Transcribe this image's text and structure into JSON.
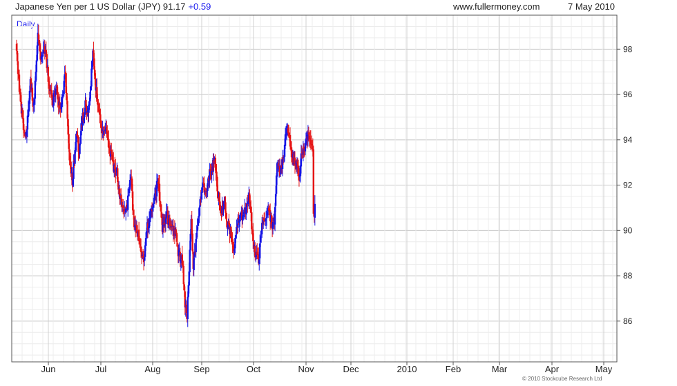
{
  "header": {
    "title": "Japanese Yen per 1 US Dollar (JPY) 91.17",
    "change": "+0.59",
    "site": "www.fullermoney.com",
    "date": "7 May 2010",
    "period": "Daily",
    "copyright": "© 2010 Stockcube Research Ltd"
  },
  "colors": {
    "up": "#1414e6",
    "down": "#e61414",
    "grid": "#d4d4d4",
    "axis": "#555555"
  },
  "chart_data": {
    "type": "candlestick",
    "title": "Japanese Yen per 1 US Dollar (JPY)",
    "last": 91.17,
    "change": 0.59,
    "ylim": [
      84.2,
      99.5
    ],
    "y_ticks": [
      86,
      88,
      90,
      92,
      94,
      96,
      98
    ],
    "x_ticks": [
      "Jun",
      "Jul",
      "Aug",
      "Sep",
      "Oct",
      "Nov",
      "Dec",
      "2010",
      "Feb",
      "Mar",
      "Apr",
      "May"
    ],
    "grid": true,
    "y_axis_side": "right",
    "anchors_comment_free": true,
    "price_path": [
      [
        0,
        97.9
      ],
      [
        7,
        95.2
      ],
      [
        14,
        94.0
      ],
      [
        20,
        96.6
      ],
      [
        25,
        95.5
      ],
      [
        31,
        98.7
      ],
      [
        35,
        97.4
      ],
      [
        41,
        98.0
      ],
      [
        46,
        96.8
      ],
      [
        52,
        95.6
      ],
      [
        58,
        96.2
      ],
      [
        63,
        95.3
      ],
      [
        71,
        97.0
      ],
      [
        77,
        93.0
      ],
      [
        81,
        92.2
      ],
      [
        87,
        94.3
      ],
      [
        91,
        93.5
      ],
      [
        95,
        94.8
      ],
      [
        100,
        95.5
      ],
      [
        104,
        94.9
      ],
      [
        111,
        97.8
      ],
      [
        116,
        96.1
      ],
      [
        122,
        94.6
      ],
      [
        131,
        94.3
      ],
      [
        141,
        92.7
      ],
      [
        146,
        92.5
      ],
      [
        153,
        91.0
      ],
      [
        159,
        90.7
      ],
      [
        166,
        92.4
      ],
      [
        171,
        90.2
      ],
      [
        177,
        89.7
      ],
      [
        185,
        88.5
      ],
      [
        189,
        90.0
      ],
      [
        198,
        91.1
      ],
      [
        206,
        92.2
      ],
      [
        212,
        90.0
      ],
      [
        218,
        90.8
      ],
      [
        224,
        90.0
      ],
      [
        231,
        89.9
      ],
      [
        236,
        88.9
      ],
      [
        242,
        88.5
      ],
      [
        245,
        86.6
      ],
      [
        248,
        86.3
      ],
      [
        250,
        87.4
      ],
      [
        254,
        90.5
      ],
      [
        257,
        88.2
      ],
      [
        261,
        89.5
      ],
      [
        266,
        90.9
      ],
      [
        271,
        92.1
      ],
      [
        275,
        91.4
      ],
      [
        281,
        92.6
      ],
      [
        285,
        92.8
      ],
      [
        288,
        93.3
      ],
      [
        293,
        91.4
      ],
      [
        297,
        90.8
      ],
      [
        302,
        91.2
      ],
      [
        307,
        90.2
      ],
      [
        312,
        89.8
      ],
      [
        316,
        89.0
      ],
      [
        321,
        90.2
      ],
      [
        325,
        90.8
      ],
      [
        330,
        90.6
      ],
      [
        334,
        91.0
      ],
      [
        338,
        91.5
      ],
      [
        341,
        90.6
      ],
      [
        344,
        89.3
      ],
      [
        348,
        88.9
      ],
      [
        352,
        88.6
      ],
      [
        356,
        90.0
      ],
      [
        361,
        90.4
      ],
      [
        366,
        90.9
      ],
      [
        371,
        90.3
      ],
      [
        375,
        90.5
      ],
      [
        379,
        93.0
      ],
      [
        384,
        92.5
      ],
      [
        389,
        93.3
      ],
      [
        392,
        94.5
      ],
      [
        396,
        94.1
      ],
      [
        400,
        93.2
      ],
      [
        404,
        93.0
      ],
      [
        408,
        92.8
      ],
      [
        411,
        92.4
      ],
      [
        415,
        93.4
      ],
      [
        418,
        93.4
      ],
      [
        421,
        94.3
      ],
      [
        425,
        94.0
      ],
      [
        429,
        93.5
      ],
      [
        431,
        93.8
      ],
      [
        432,
        90.6
      ],
      [
        434,
        91.17
      ]
    ]
  }
}
